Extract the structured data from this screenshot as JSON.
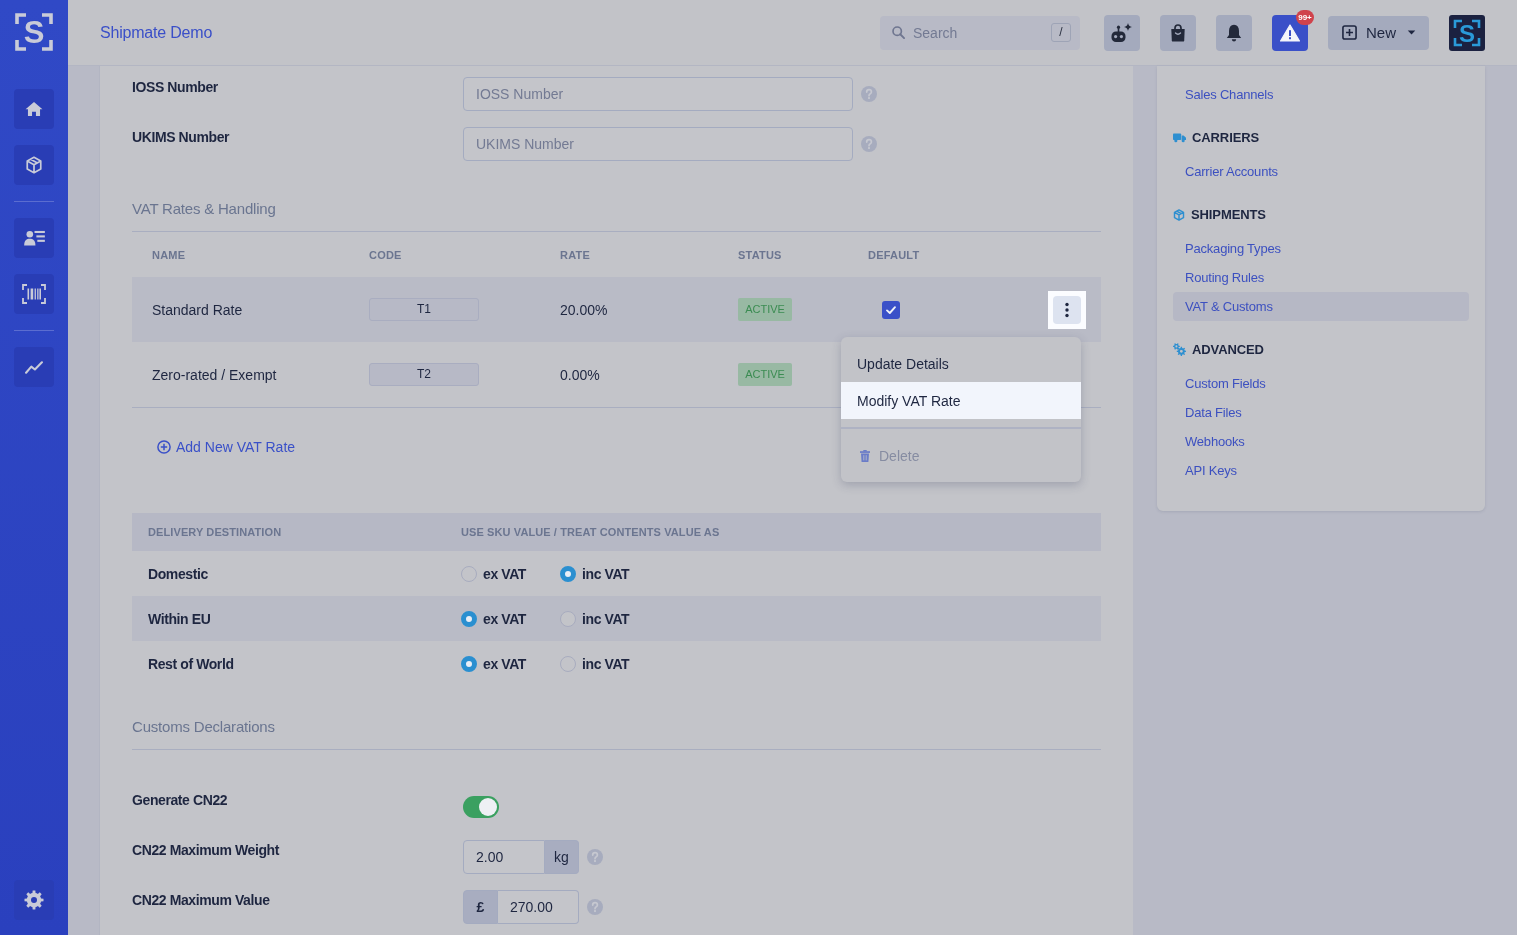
{
  "sidebar": {
    "logo_text": "S",
    "nav_groups": [
      {
        "items": [
          {
            "kind": "home",
            "selected": false
          },
          {
            "kind": "package",
            "selected": false
          }
        ]
      },
      {
        "items": [
          {
            "kind": "contacts",
            "selected": false
          },
          {
            "kind": "barcode",
            "selected": false
          }
        ]
      },
      {
        "items": [
          {
            "kind": "analytics",
            "selected": false
          }
        ]
      }
    ],
    "footer_items": [
      {
        "kind": "settings",
        "selected": false
      }
    ]
  },
  "top_bar": {
    "title": "Shipmate Demo",
    "search": {
      "placeholder": "Search",
      "shortcut": "/"
    },
    "icon_buttons": [
      {
        "kind": "assistant"
      },
      {
        "kind": "orders"
      },
      {
        "kind": "notifications"
      },
      {
        "kind": "alerts",
        "badge": "99+"
      }
    ],
    "new_button": {
      "label": "New"
    },
    "logo_text": "S"
  },
  "ids": {
    "fields": [
      {
        "label": "IOSS Number",
        "placeholder": "IOSS Number"
      },
      {
        "label": "UKIMS Number",
        "placeholder": "UKIMS Number"
      }
    ]
  },
  "vat_rates": {
    "title": "VAT Rates & Handling",
    "columns": [
      "NAME",
      "CODE",
      "RATE",
      "STATUS",
      "DEFAULT"
    ],
    "rows": [
      {
        "name": "Standard Rate",
        "code": "T1",
        "rate": "20.00%",
        "status": "ACTIVE",
        "is_default": true,
        "menu_open": true
      },
      {
        "name": "Zero-rated / Exempt",
        "code": "T2",
        "rate": "0.00%",
        "status": "ACTIVE",
        "menu_open": false
      }
    ],
    "menu": {
      "items": [
        {
          "kind": "action",
          "label": "Update Details",
          "highlighted": false,
          "disabled": false
        },
        {
          "kind": "action",
          "label": "Modify VAT Rate",
          "highlighted": true,
          "disabled": false
        },
        {
          "kind": "delete",
          "label": "Delete",
          "highlighted": false,
          "disabled": true
        }
      ]
    },
    "add_link": "Add New VAT Rate"
  },
  "delivery": {
    "columns": [
      "DELIVERY DESTINATION",
      "USE SKU VALUE / TREAT CONTENTS VALUE AS"
    ],
    "rows": [
      {
        "destination": "Domestic",
        "options": [
          {
            "label": "ex VAT",
            "selected": false
          },
          {
            "label": "inc VAT",
            "selected": true
          }
        ]
      },
      {
        "destination": "Within EU",
        "options": [
          {
            "label": "ex VAT",
            "selected": true
          },
          {
            "label": "inc VAT",
            "selected": false
          }
        ]
      },
      {
        "destination": "Rest of World",
        "options": [
          {
            "label": "ex VAT",
            "selected": true
          },
          {
            "label": "inc VAT",
            "selected": false
          }
        ]
      }
    ]
  },
  "customs": {
    "title": "Customs Declarations",
    "generate_cn22": {
      "label": "Generate CN22",
      "on": true
    },
    "max_weight": {
      "label": "CN22 Maximum Weight",
      "value": "2.00",
      "unit": "kg"
    },
    "max_value": {
      "label": "CN22 Maximum Value",
      "currency": "£",
      "value": "270.00"
    }
  },
  "settings_nav": {
    "groups": [
      {
        "items": [
          {
            "label": "Sales Channels",
            "selected": false
          }
        ]
      },
      {
        "heading": "CARRIERS",
        "items": [
          {
            "label": "Carrier Accounts",
            "selected": false
          }
        ]
      },
      {
        "heading": "SHIPMENTS",
        "items": [
          {
            "label": "Packaging Types",
            "selected": false
          },
          {
            "label": "Routing Rules",
            "selected": false
          },
          {
            "label": "VAT & Customs",
            "selected": true
          }
        ]
      },
      {
        "heading": "ADVANCED",
        "items": [
          {
            "label": "Custom Fields",
            "selected": false
          },
          {
            "label": "Data Files",
            "selected": false
          },
          {
            "label": "Webhooks",
            "selected": false
          },
          {
            "label": "API Keys",
            "selected": false
          }
        ]
      }
    ]
  }
}
